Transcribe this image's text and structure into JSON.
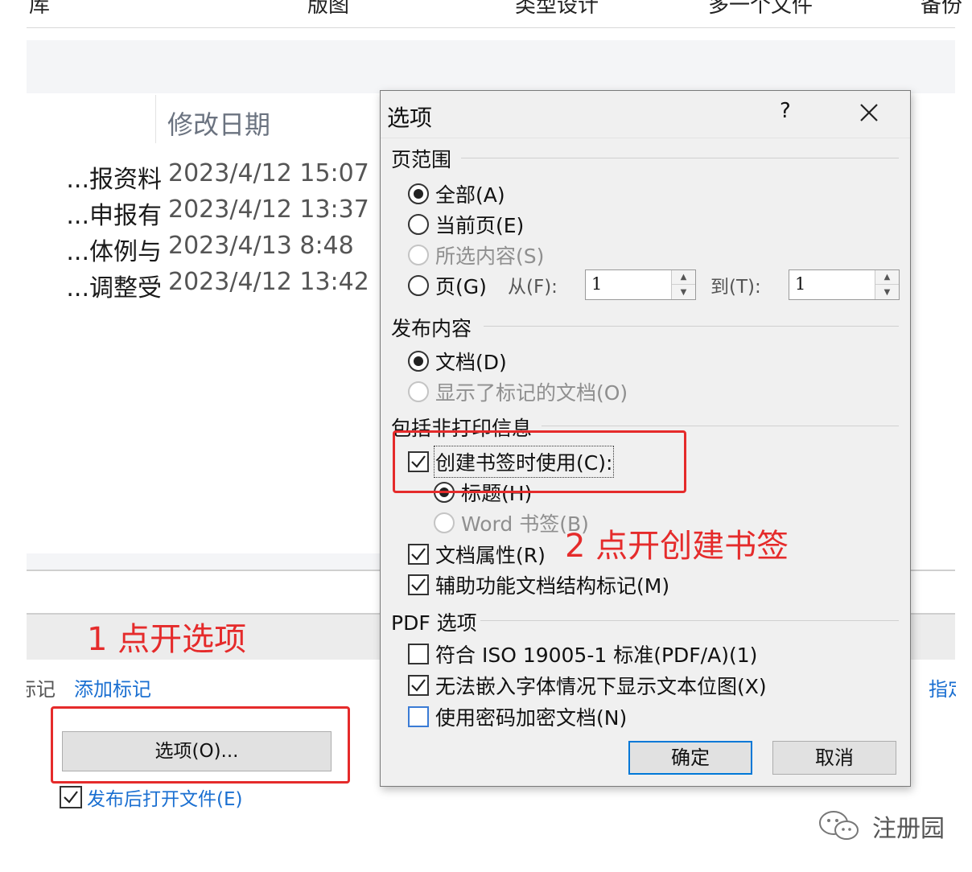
{
  "background": {
    "top_strip_fragments": [
      "库",
      "版图",
      "类型设计",
      "多一个文件",
      "备份"
    ],
    "column_header": "修改日期",
    "files": [
      {
        "name": "报资料...",
        "date": "2023/4/12 15:07"
      },
      {
        "name": "申报有...",
        "date": "2023/4/12 13:37"
      },
      {
        "name": "体例与...",
        "date": "2023/4/13 8:48"
      },
      {
        "name": "调整受...",
        "date": "2023/4/12 13:42"
      }
    ],
    "tag_label": "标记:",
    "add_tag_link": "添加标记",
    "right_link": "指定",
    "options_button": "选项(O)...",
    "open_after_publish": "发布后打开文件(E)",
    "open_after_publish_checked": true
  },
  "dialog": {
    "title": "选项",
    "help": "?",
    "page_range": {
      "group_label": "页范围",
      "all": "全部(A)",
      "current_page": "当前页(E)",
      "selection": "所选内容(S)",
      "pages": "页(G)",
      "from_label": "从(F):",
      "from_value": "1",
      "to_label": "到(T):",
      "to_value": "1",
      "selected": "all"
    },
    "publish_content": {
      "group_label": "发布内容",
      "document": "文档(D)",
      "document_with_markup": "显示了标记的文档(O)",
      "selected": "document"
    },
    "non_printing": {
      "group_label": "包括非打印信息",
      "create_bookmarks": "创建书签时使用(C):",
      "create_bookmarks_checked": true,
      "headings": "标题(H)",
      "word_bookmarks": "Word 书签(B)",
      "bookmark_source": "headings",
      "document_properties": "文档属性(R)",
      "document_properties_checked": true,
      "accessibility_tags": "辅助功能文档结构标记(M)",
      "accessibility_tags_checked": true
    },
    "pdf_options": {
      "group_label": "PDF 选项",
      "iso_compliant": "符合 ISO 19005-1 标准(PDF/A)(1)",
      "iso_compliant_checked": false,
      "bitmap_text": "无法嵌入字体情况下显示文本位图(X)",
      "bitmap_text_checked": true,
      "encrypt": "使用密码加密文档(N)",
      "encrypt_checked": false
    },
    "ok_button": "确定",
    "cancel_button": "取消"
  },
  "annotations": {
    "step1": "1 点开选项",
    "step2": "2 点开创建书签",
    "color": "#e52b2b"
  },
  "watermark": {
    "text": "注册园",
    "icon": "wechat-icon"
  },
  "colors": {
    "link": "#1a6fd1",
    "primary_button_border": "#0078d7"
  }
}
